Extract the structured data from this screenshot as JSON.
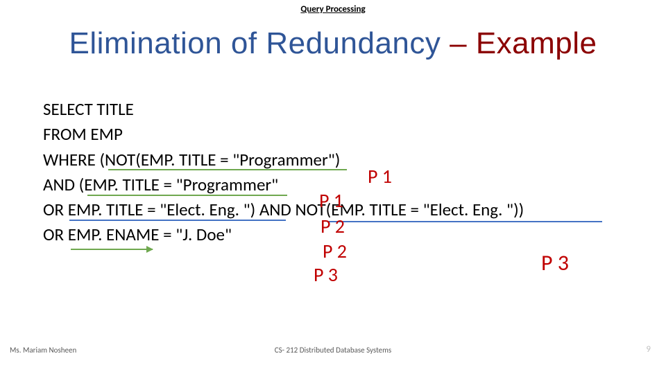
{
  "header": {
    "topic": "Query Processing"
  },
  "title": {
    "part1": "Elimination of Redundancy  ",
    "part2": "– Example"
  },
  "sql": {
    "l1": "SELECT TITLE",
    "l2": "FROM EMP",
    "l3": "WHERE (NOT(EMP. TITLE = \"Programmer\")",
    "l4": "AND (EMP. TITLE = \"Programmer\"",
    "l5": "OR EMP. TITLE = \"Elect. Eng. \") AND NOT(EMP. TITLE = \"Elect. Eng. \"))",
    "l6": "OR EMP. ENAME = \"J. Doe\""
  },
  "annotations": {
    "a1": "P 1",
    "a2": "P 1",
    "a3": "P 2",
    "a4": "P 2",
    "a5": "P 3",
    "a6": "P 3"
  },
  "footer": {
    "author": "Ms. Mariam Nosheen",
    "course": "CS- 212 Distributed Database Systems",
    "page": "9"
  }
}
